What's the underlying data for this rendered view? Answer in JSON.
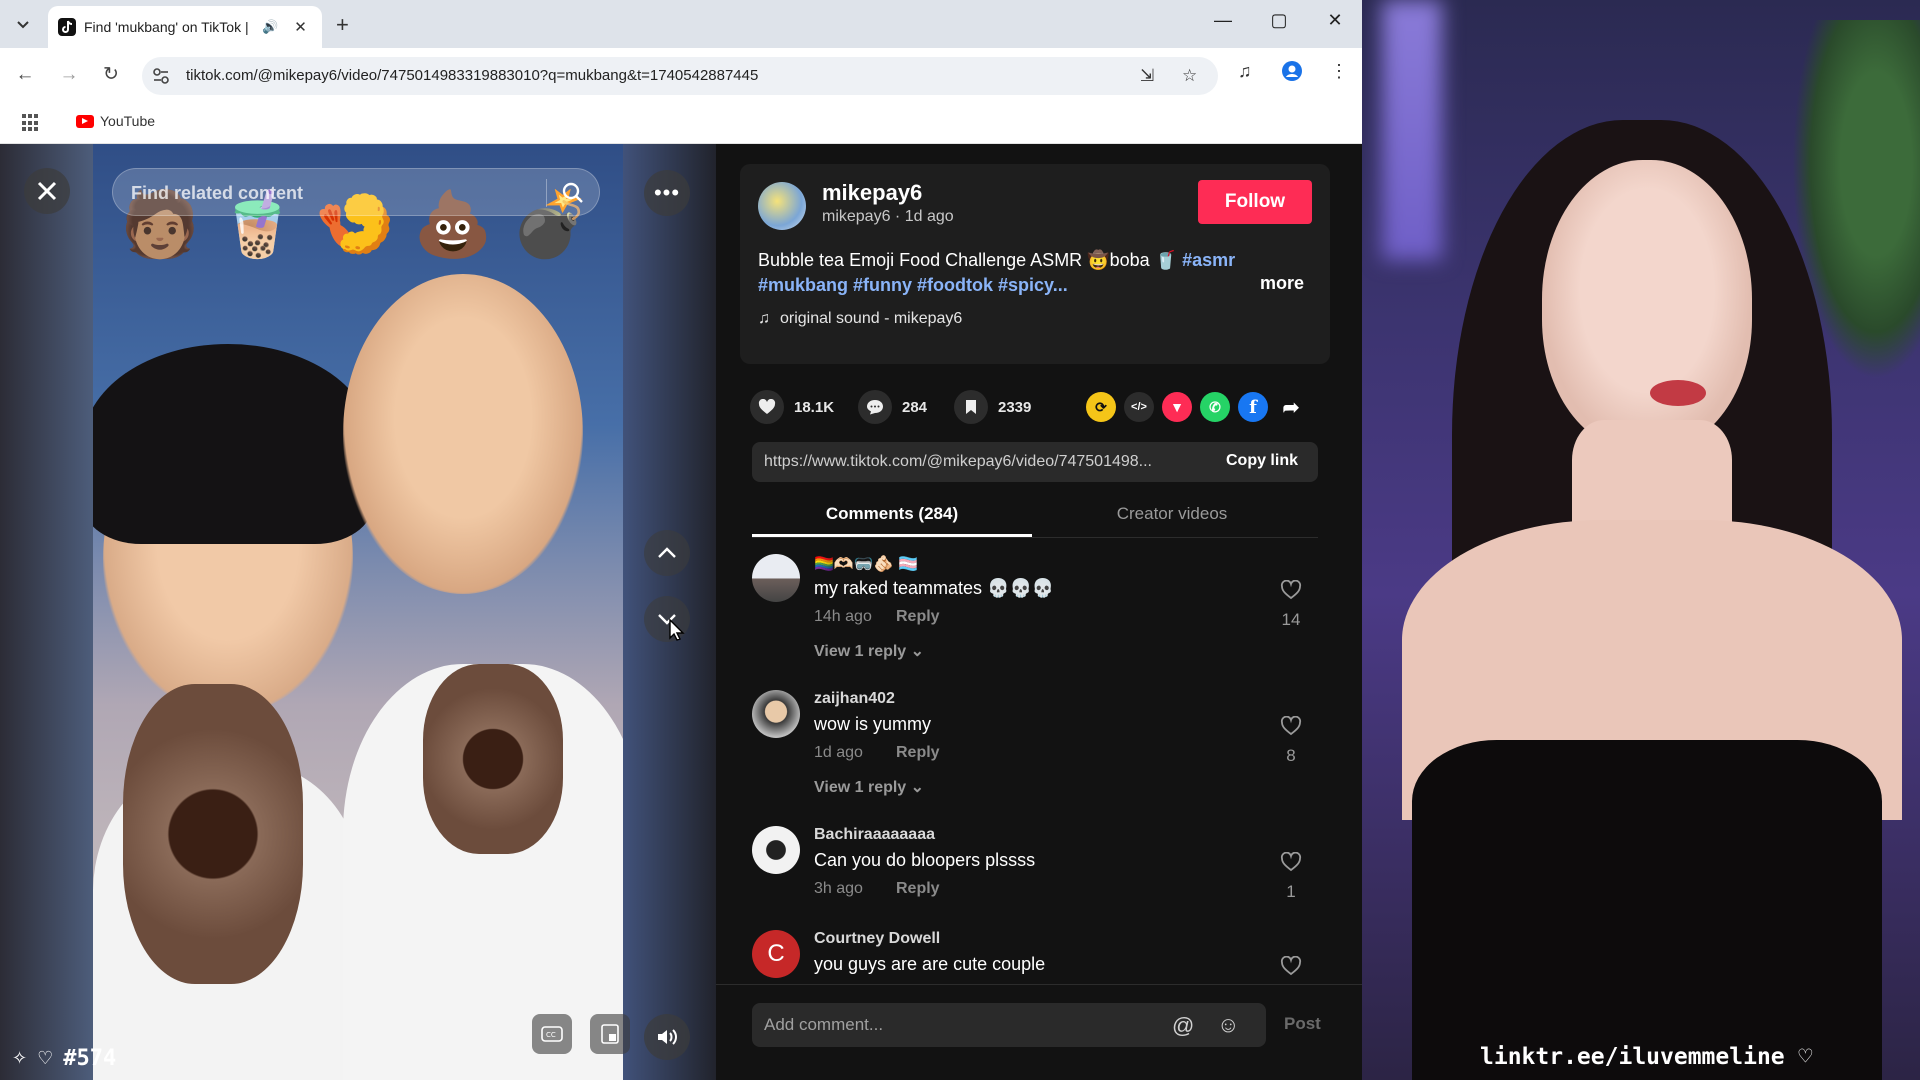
{
  "browser": {
    "tab_title": "Find 'mukbang' on TikTok |",
    "url": "tiktok.com/@mikepay6/video/7475014983319883010?q=mukbang&t=1740542887445",
    "bookmark_youtube": "YouTube"
  },
  "video": {
    "search_placeholder": "Find related content"
  },
  "post": {
    "author": "mikepay6",
    "author_sub": "mikepay6 · 1d ago",
    "follow_label": "Follow",
    "desc_text": "Bubble tea Emoji Food Challenge ASMR 🤠boba 🥤",
    "tags_line1": "#asmr",
    "tags_line2": "#mukbang #funny #foodtok #spicy...",
    "more_label": "more",
    "sound": "original sound - mikepay6"
  },
  "actions": {
    "likes": "18.1K",
    "comments": "284",
    "saves": "2339"
  },
  "share": {
    "link": "https://www.tiktok.com/@mikepay6/video/747501498...",
    "copy_label": "Copy link"
  },
  "tabs": {
    "comments": "Comments (284)",
    "creator": "Creator videos"
  },
  "comments": [
    {
      "user": "🏳️‍🌈🫶🏻🥽🫵🏻 🏳️‍⚧️",
      "text": "my raked teammates 💀💀💀",
      "time": "14h ago",
      "reply": "Reply",
      "view": "View 1 reply",
      "likes": "14"
    },
    {
      "user": "zaijhan402",
      "text": "wow is yummy",
      "time": "1d ago",
      "reply": "Reply",
      "view": "View 1 reply",
      "likes": "8"
    },
    {
      "user": "Bachiraaaaaaaa",
      "text": "Can you do bloopers plssss",
      "time": "3h ago",
      "reply": "Reply",
      "likes": "1"
    },
    {
      "user": "Courtney Dowell",
      "text": "you guys are are cute couple",
      "avatar_letter": "C"
    }
  ],
  "comment_bar": {
    "placeholder": "Add comment...",
    "post_label": "Post"
  },
  "overlay": {
    "count": "#574",
    "link": "linktr.ee/iluvemmeline ♡"
  },
  "colors": {
    "follow": "#fe2c55",
    "hashtag": "#8ab4f8"
  }
}
